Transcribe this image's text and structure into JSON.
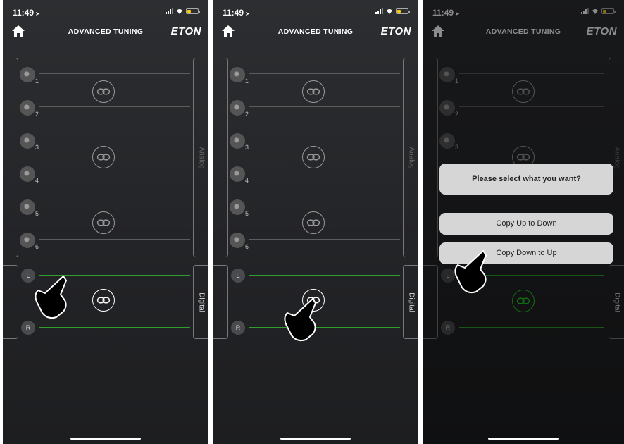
{
  "status_bar": {
    "time": "11:49"
  },
  "header": {
    "title": "ADVANCED TUNING",
    "logo": "ETON"
  },
  "channels": [
    "1",
    "2",
    "3",
    "4",
    "5",
    "6"
  ],
  "tabs": {
    "analog": "Analog",
    "digital": "Digital"
  },
  "digital_channels": {
    "left": "L",
    "right": "R"
  },
  "dialog": {
    "title": "Please select what you want?",
    "options": [
      "Copy Up to Down",
      "Copy Down to Up"
    ]
  },
  "colors": {
    "link_active": "#1fc61f",
    "green_line": "#2f9e2f",
    "background": "#232427"
  },
  "icons": [
    "home-icon",
    "link-icon",
    "hand-pointer-icon",
    "signal-icon",
    "wifi-icon",
    "battery-icon"
  ]
}
